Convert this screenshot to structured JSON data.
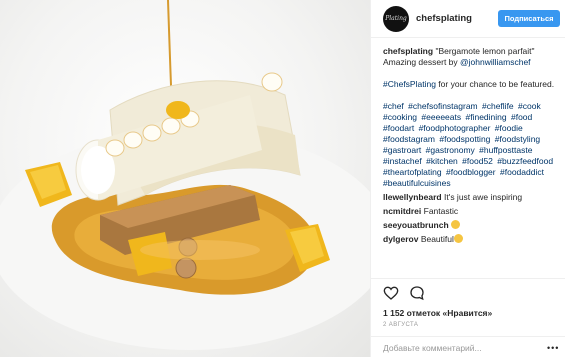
{
  "header": {
    "avatar_text": "Plating",
    "username": "chefsplating",
    "follow_label": "Подписаться"
  },
  "caption": {
    "username": "chefsplating",
    "title": "\"Bergamote lemon parfait\"",
    "line2_prefix": "Amazing dessert by ",
    "mention": "@johnwilliamschef",
    "line3_tag": "#ChefsPlating",
    "line3_rest": " for your chance to be featured."
  },
  "hashtags": [
    "#chef",
    "#chefsofinstagram",
    "#cheflife",
    "#cook",
    "#cooking",
    "#eeeeeats",
    "#finedining",
    "#food",
    "#foodart",
    "#foodphotographer",
    "#foodie",
    "#foodstagram",
    "#foodspotting",
    "#foodstyling",
    "#gastroart",
    "#gastronomy",
    "#huffposttaste",
    "#instachef",
    "#kitchen",
    "#food52",
    "#buzzfeedfood",
    "#theartofplating",
    "#foodblogger",
    "#foodaddict",
    "#beautifulcuisines"
  ],
  "comments": [
    {
      "user": "llewellynbeard",
      "text": "It's just awe inspiring",
      "emoji": ""
    },
    {
      "user": "ncmitdrei",
      "text": "Fantastic",
      "emoji": ""
    },
    {
      "user": "seeyouatbrunch",
      "text": "",
      "emoji": "clapping-hands"
    },
    {
      "user": "dylgerov",
      "text": "Beautiful",
      "emoji": "clapping-hands"
    }
  ],
  "actions": {
    "likes": "1 152 отметок «Нравится»",
    "date": "2 АВГУСТА",
    "comment_placeholder": "Добавьте комментарий...",
    "more": "•••"
  },
  "colors": {
    "follow_button": "#3897f0",
    "hashtag": "#003569",
    "text": "#262626",
    "muted": "#999999"
  }
}
